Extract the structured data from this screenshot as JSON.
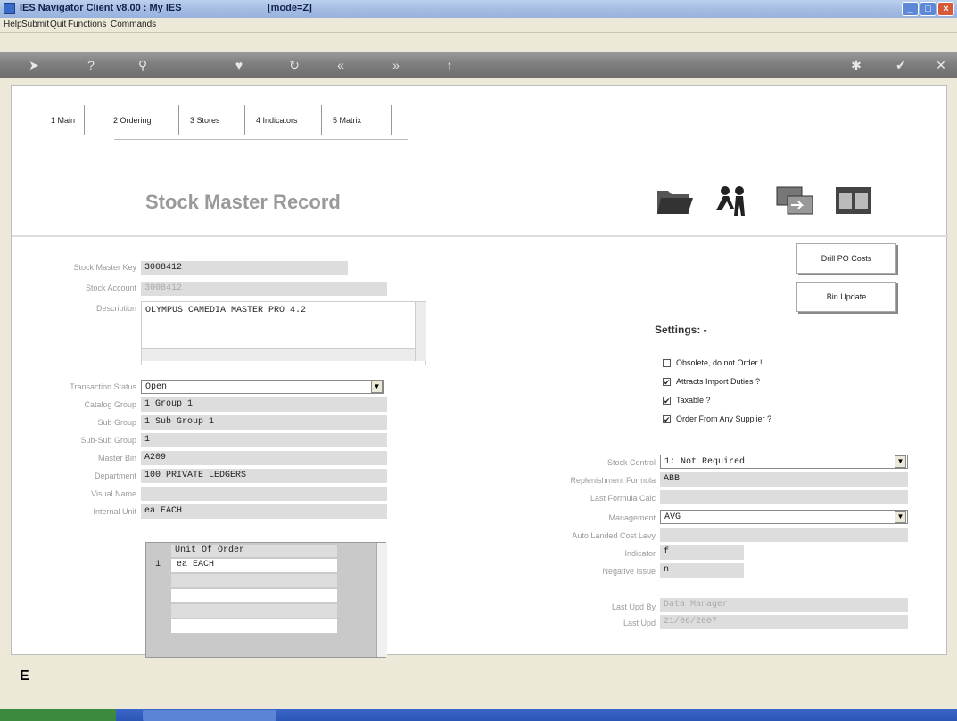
{
  "window": {
    "title": "IES Navigator Client v8.00 : My IES",
    "mode": "[mode=Z]",
    "min_glyph": "_",
    "max_glyph": "□",
    "close_glyph": "×"
  },
  "menu": [
    "Help",
    "Submit",
    "Quit",
    "Functions",
    "Commands"
  ],
  "toolbar": {
    "icons": [
      "arrow-icon",
      "help-icon",
      "search-icon",
      "heart-icon",
      "refresh-icon",
      "back-icon",
      "forward-icon",
      "up-icon",
      "gear-icon",
      "check-icon",
      "close-icon"
    ],
    "glyphs": [
      "➤",
      "?",
      "⚲",
      "♥",
      "↻",
      "«",
      "»",
      "↑",
      "✱",
      "✔",
      "✕"
    ]
  },
  "tabs": [
    "1 Main",
    "2 Ordering",
    "3 Stores",
    "4 Indicators",
    "5 Matrix"
  ],
  "page_title": "Stock Master Record",
  "fields_left": {
    "stock_master_key": {
      "label": "Stock Master Key",
      "value": "3008412"
    },
    "stock_account": {
      "label": "Stock Account",
      "value": "3008412"
    },
    "description": {
      "label": "Description",
      "value": "OLYMPUS CAMEDIA MASTER PRO 4.2"
    },
    "transaction_status": {
      "label": "Transaction Status",
      "value": "Open"
    },
    "catalog_group": {
      "label": "Catalog Group",
      "value": "1 Group 1"
    },
    "sub_group": {
      "label": "Sub Group",
      "value": "1 Sub Group 1"
    },
    "sub_sub_group": {
      "label": "Sub-Sub Group",
      "value": "1"
    },
    "master_bin": {
      "label": "Master Bin",
      "value": "A209"
    },
    "department": {
      "label": "Department",
      "value": "100 PRIVATE LEDGERS"
    },
    "visual_name": {
      "label": "Visual Name",
      "value": ""
    },
    "internal_unit": {
      "label": "Internal Unit",
      "value": "ea EACH"
    }
  },
  "unit_grid": {
    "header": "Unit Of Order",
    "rows": [
      {
        "num": "1",
        "text": "ea EACH"
      }
    ]
  },
  "buttons": {
    "drill_po_costs": "Drill PO Costs",
    "bin_update": "Bin Update"
  },
  "settings": {
    "title": "Settings: -",
    "checks": [
      {
        "label": "Obsolete, do not Order !",
        "checked": false
      },
      {
        "label": "Attracts Import Duties ?",
        "checked": true
      },
      {
        "label": "Taxable ?",
        "checked": true
      },
      {
        "label": "Order From Any Supplier ?",
        "checked": true
      }
    ]
  },
  "fields_right": {
    "stock_control": {
      "label": "Stock Control",
      "value": "1: Not Required"
    },
    "replenishment_formula": {
      "label": "Replenishment Formula",
      "value": "ABB"
    },
    "last_formula_calc": {
      "label": "Last Formula Calc",
      "value": ""
    },
    "management": {
      "label": "Management",
      "value": "AVG"
    },
    "auto_landed_cost_levy": {
      "label": "Auto Landed Cost Levy",
      "value": ""
    },
    "indicator": {
      "label": "Indicator",
      "value": "f"
    },
    "negative_issue": {
      "label": "Negative Issue",
      "value": "n"
    },
    "last_upd_by": {
      "label": "Last Upd By",
      "value": "Data Manager"
    },
    "last_upd": {
      "label": "Last Upd",
      "value": "21/06/2007"
    }
  },
  "bottom_fragment": "E"
}
